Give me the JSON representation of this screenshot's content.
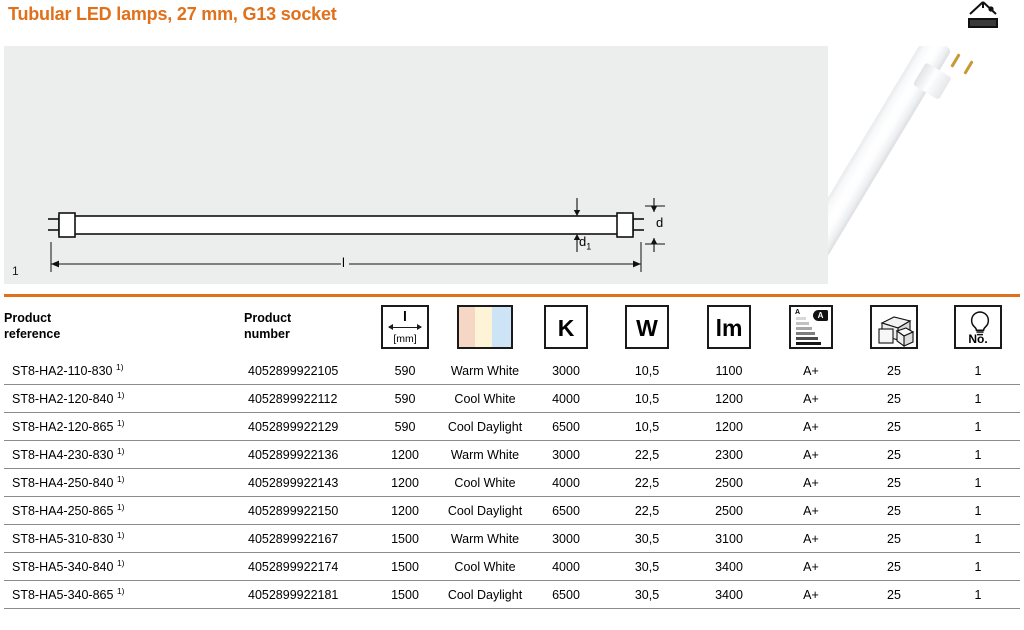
{
  "header": {
    "title": "Tubular LED lamps, 27 mm, G13 socket",
    "title_color": "#e1701a",
    "fixture_icon": "luminaire-icon"
  },
  "product_figure": {
    "figure_number": "1",
    "dimension_labels": {
      "length": "l",
      "diameter_body": "d",
      "diameter_sub": "1",
      "diameter_cap": "d"
    },
    "photo_alt": "led-tube-photo"
  },
  "table": {
    "headers": {
      "product_reference": "Product\nreference",
      "product_reference_line1": "Product",
      "product_reference_line2": "reference",
      "product_number_line1": "Product",
      "product_number_line2": "number",
      "length_symbol": "l",
      "length_unit": "[mm]",
      "color_swatch": "color-temperature-swatch",
      "kelvin": "K",
      "watt": "W",
      "lumen": "lm",
      "energy_label": "energy-efficiency-icon",
      "packaging": "packaging-unit-icon",
      "number_label": "No."
    },
    "footnote_marker": "1)",
    "rows": [
      {
        "reference": "ST8-HA2-110-830",
        "number": "4052899922105",
        "length": "590",
        "color": "Warm White",
        "kelvin": "3000",
        "watt": "10,5",
        "lumen": "1100",
        "energy_class": "A+",
        "packaging": "25",
        "no": "1"
      },
      {
        "reference": "ST8-HA2-120-840",
        "number": "4052899922112",
        "length": "590",
        "color": "Cool White",
        "kelvin": "4000",
        "watt": "10,5",
        "lumen": "1200",
        "energy_class": "A+",
        "packaging": "25",
        "no": "1"
      },
      {
        "reference": "ST8-HA2-120-865",
        "number": "4052899922129",
        "length": "590",
        "color": "Cool Daylight",
        "kelvin": "6500",
        "watt": "10,5",
        "lumen": "1200",
        "energy_class": "A+",
        "packaging": "25",
        "no": "1"
      },
      {
        "reference": "ST8-HA4-230-830",
        "number": "4052899922136",
        "length": "1200",
        "color": "Warm White",
        "kelvin": "3000",
        "watt": "22,5",
        "lumen": "2300",
        "energy_class": "A+",
        "packaging": "25",
        "no": "1"
      },
      {
        "reference": "ST8-HA4-250-840",
        "number": "4052899922143",
        "length": "1200",
        "color": "Cool White",
        "kelvin": "4000",
        "watt": "22,5",
        "lumen": "2500",
        "energy_class": "A+",
        "packaging": "25",
        "no": "1"
      },
      {
        "reference": "ST8-HA4-250-865",
        "number": "4052899922150",
        "length": "1200",
        "color": "Cool Daylight",
        "kelvin": "6500",
        "watt": "22,5",
        "lumen": "2500",
        "energy_class": "A+",
        "packaging": "25",
        "no": "1"
      },
      {
        "reference": "ST8-HA5-310-830",
        "number": "4052899922167",
        "length": "1500",
        "color": "Warm White",
        "kelvin": "3000",
        "watt": "30,5",
        "lumen": "3100",
        "energy_class": "A+",
        "packaging": "25",
        "no": "1"
      },
      {
        "reference": "ST8-HA5-340-840",
        "number": "4052899922174",
        "length": "1500",
        "color": "Cool White",
        "kelvin": "4000",
        "watt": "30,5",
        "lumen": "3400",
        "energy_class": "A+",
        "packaging": "25",
        "no": "1"
      },
      {
        "reference": "ST8-HA5-340-865",
        "number": "4052899922181",
        "length": "1500",
        "color": "Cool Daylight",
        "kelvin": "6500",
        "watt": "30,5",
        "lumen": "3400",
        "energy_class": "A+",
        "packaging": "25",
        "no": "1"
      }
    ]
  },
  "colors": {
    "accent": "#e1701a",
    "image_background": "#eceded",
    "rule": "#8b8b8b"
  }
}
